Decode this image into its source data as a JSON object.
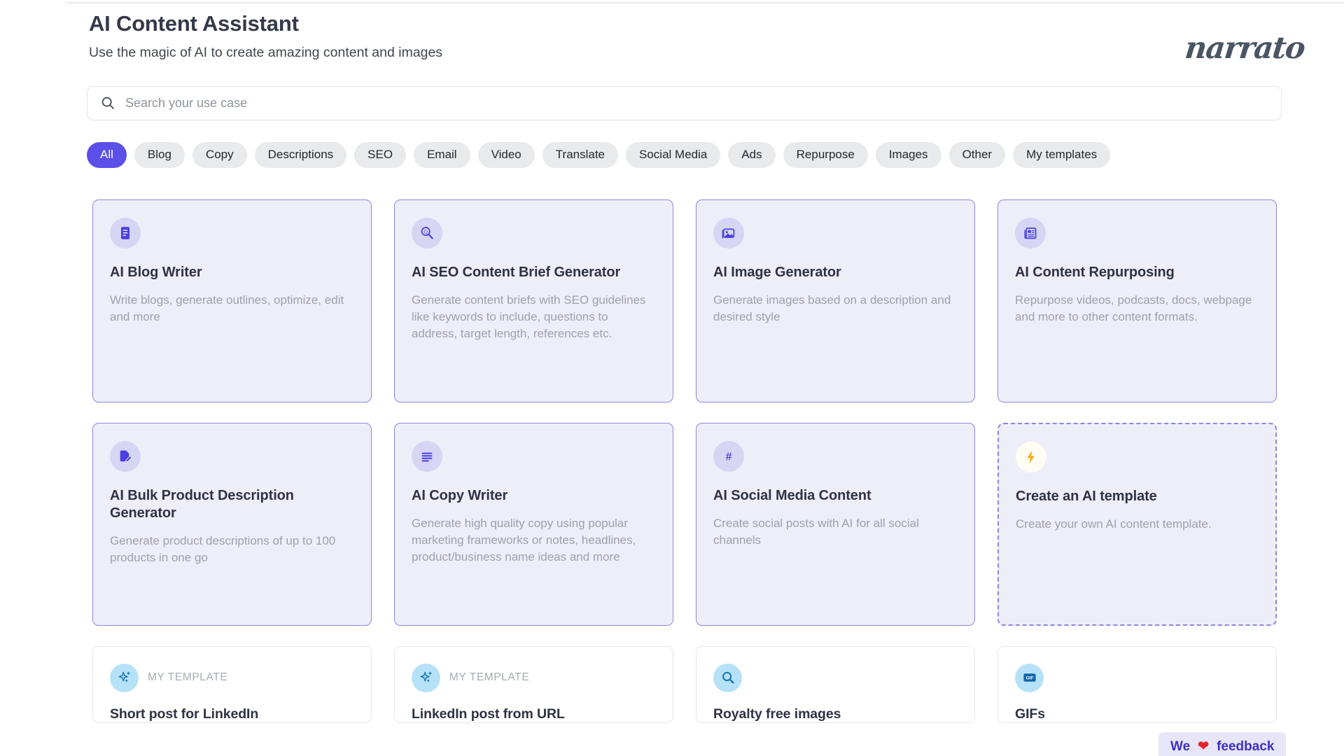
{
  "header": {
    "title": "AI Content Assistant",
    "subtitle": "Use the magic of AI to create amazing content and images",
    "brand": "narrato"
  },
  "search": {
    "placeholder": "Search your use case",
    "value": "",
    "icon": "search-icon"
  },
  "filters": {
    "active": "All",
    "chips": [
      {
        "label": "All",
        "active": true
      },
      {
        "label": "Blog",
        "active": false
      },
      {
        "label": "Copy",
        "active": false
      },
      {
        "label": "Descriptions",
        "active": false
      },
      {
        "label": "SEO",
        "active": false
      },
      {
        "label": "Email",
        "active": false
      },
      {
        "label": "Video",
        "active": false
      },
      {
        "label": "Translate",
        "active": false
      },
      {
        "label": "Social Media",
        "active": false
      },
      {
        "label": "Ads",
        "active": false
      },
      {
        "label": "Repurpose",
        "active": false
      },
      {
        "label": "Images",
        "active": false
      },
      {
        "label": "Other",
        "active": false
      },
      {
        "label": "My templates",
        "active": false
      }
    ]
  },
  "cards": [
    {
      "title": "AI Blog Writer",
      "desc": "Write blogs, generate outlines, optimize, edit and more",
      "icon": "document-lines-icon"
    },
    {
      "title": "AI SEO Content Brief Generator",
      "desc": "Generate content briefs with SEO guidelines like keywords to include, questions to address, target length, references etc.",
      "icon": "magnifier-q-icon"
    },
    {
      "title": "AI Image Generator",
      "desc": "Generate images based on a description and desired style",
      "icon": "image-icon"
    },
    {
      "title": "AI Content Repurposing",
      "desc": "Repurpose videos, podcasts, docs, webpage and more to other content formats.",
      "icon": "newspaper-icon"
    },
    {
      "title": "AI Bulk Product Description Generator",
      "desc": "Generate product descriptions of up to 100 products in one go",
      "icon": "document-pencil-icon"
    },
    {
      "title": "AI Copy Writer",
      "desc": "Generate high quality copy using popular marketing frameworks or notes, headlines, product/business name ideas and more",
      "icon": "text-lines-icon"
    },
    {
      "title": "AI Social Media Content",
      "desc": "Create social posts with AI for all social channels",
      "icon": "hashtag-icon"
    },
    {
      "title": "Create an AI template",
      "desc": "Create your own AI content template.",
      "icon": "lightning-bolt-icon",
      "dashed": true
    }
  ],
  "template_cards": [
    {
      "tag": "MY TEMPLATE",
      "title": "Short post for LinkedIn",
      "icon": "sparkle-icon"
    },
    {
      "tag": "MY TEMPLATE",
      "title": "LinkedIn post from URL",
      "icon": "sparkle-icon"
    },
    {
      "tag": "",
      "title": "Royalty free images",
      "icon": "search-circle-icon"
    },
    {
      "tag": "",
      "title": "GIFs",
      "icon": "gif-icon"
    }
  ],
  "feedback": {
    "prefix": "We",
    "heart": "❤",
    "suffix": "feedback"
  },
  "colors": {
    "accent": "#5a4fe8",
    "card_bg": "#eeeef9",
    "card_border": "#8b87e0",
    "chip_bg": "#e9eaec",
    "icon_bg": "#d6d5f4",
    "lite_icon_bg": "#b6e2f8",
    "heart": "#e8232a"
  }
}
